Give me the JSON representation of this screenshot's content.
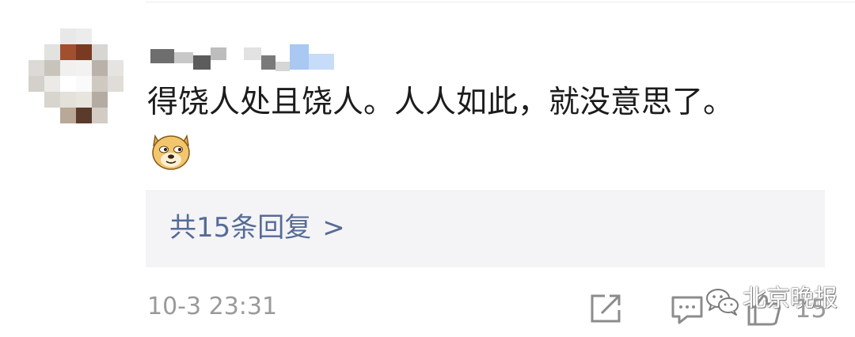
{
  "comment": {
    "text": "得饶人处且饶人。人人如此，就没意思了。",
    "emoji": "doge-emoji"
  },
  "replies": {
    "label": "共15条回复",
    "chevron": ">"
  },
  "footer": {
    "timestamp": "10-3 23:31",
    "like_count": "15",
    "watermark": "北京晚报"
  },
  "icons": [
    "share-icon",
    "comment-icon",
    "like-icon",
    "wechat-logo"
  ],
  "colors": {
    "link": "#576b95",
    "meta": "#9a9a9a",
    "reply_bg": "#f4f4f6",
    "text": "#1c1c1c"
  }
}
